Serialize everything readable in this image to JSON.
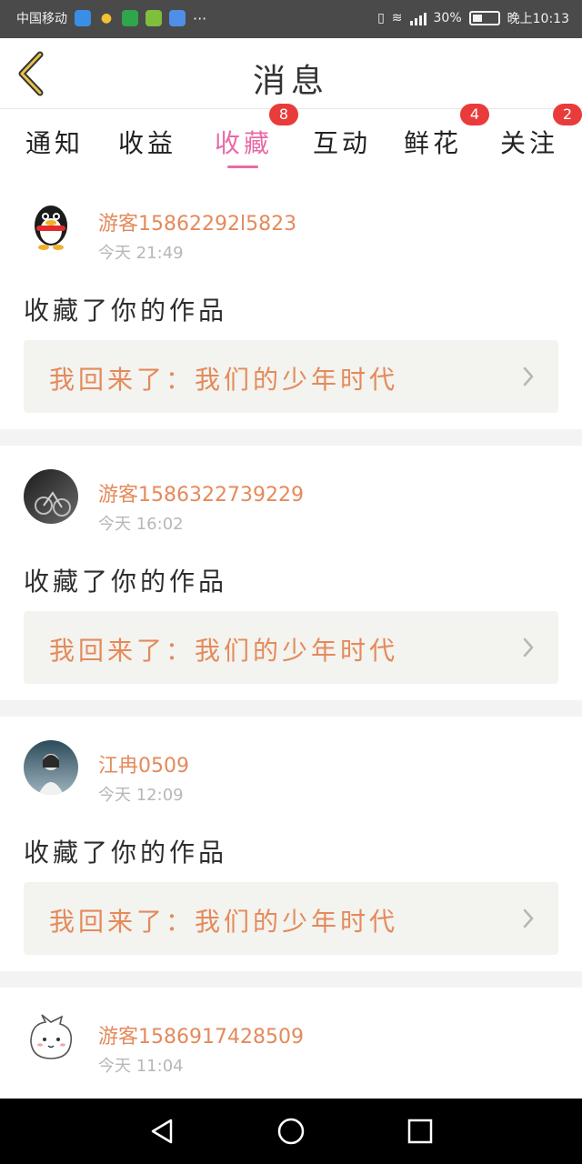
{
  "status_bar": {
    "carrier": "中国移动",
    "dots": "···",
    "battery_percent": "30%",
    "time": "晚上10:13",
    "icons": [
      "shield-icon",
      "bulb-icon",
      "book-icon",
      "play-icon",
      "ring-icon",
      "vibrate-icon",
      "wifi-icon",
      "signal-icon",
      "battery-icon"
    ]
  },
  "header": {
    "title": "消息"
  },
  "tabs": [
    {
      "label": "通知"
    },
    {
      "label": "收益"
    },
    {
      "label": "收藏",
      "badge": "8",
      "active": true
    },
    {
      "label": "互动"
    },
    {
      "label": "鲜花",
      "badge": "4"
    },
    {
      "label": "关注",
      "badge": "2"
    }
  ],
  "items": [
    {
      "name": "游客15862292l5823",
      "time": "今天 21:49",
      "action": "收藏了你的作品",
      "work_title": "我回来了：我们的少年时代",
      "avatar": "qq-penguin"
    },
    {
      "name": "游客1586322739229",
      "time": "今天 16:02",
      "action": "收藏了你的作品",
      "work_title": "我回来了：我们的少年时代",
      "avatar": "photo-dark"
    },
    {
      "name": "江冉0509",
      "time": "今天 12:09",
      "action": "收藏了你的作品",
      "work_title": "我回来了：我们的少年时代",
      "avatar": "photo-girl"
    },
    {
      "name": "游客1586917428509",
      "time": "今天 11:04",
      "avatar": "cartoon-cat"
    }
  ],
  "nav": {
    "icons": [
      "back-triangle-icon",
      "home-circle-icon",
      "recent-square-icon"
    ]
  }
}
